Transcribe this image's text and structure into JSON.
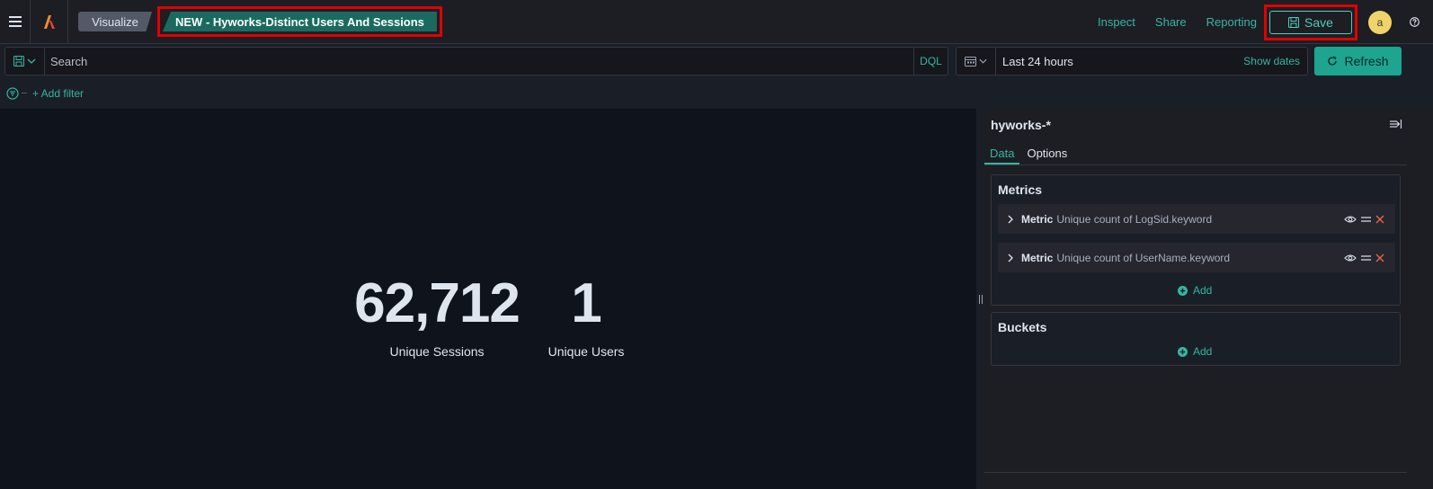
{
  "header": {
    "breadcrumbs": [
      "Visualize",
      "NEW - Hyworks-Distinct Users And Sessions"
    ],
    "links": {
      "inspect": "Inspect",
      "share": "Share",
      "reporting": "Reporting"
    },
    "save_label": "Save",
    "avatar_initial": "a",
    "icons": [
      "menu-icon",
      "logo-icon",
      "save-icon",
      "help-icon"
    ]
  },
  "query": {
    "search_placeholder": "Search",
    "language": "DQL",
    "date_range": "Last 24 hours",
    "show_dates_label": "Show dates",
    "refresh_label": "Refresh"
  },
  "filters": {
    "add_filter_label": "+ Add filter"
  },
  "visualization": {
    "metrics": [
      {
        "value": "62,712",
        "label": "Unique Sessions"
      },
      {
        "value": "1",
        "label": "Unique Users"
      }
    ]
  },
  "sidebar": {
    "index_pattern": "hyworks-*",
    "tabs": [
      "Data",
      "Options"
    ],
    "active_tab": "Data",
    "metrics_title": "Metrics",
    "metric_aggs": [
      {
        "type": "Metric",
        "description": "Unique count of LogSid.keyword"
      },
      {
        "type": "Metric",
        "description": "Unique count of UserName.keyword"
      }
    ],
    "buckets_title": "Buckets",
    "add_label": "Add"
  },
  "colors": {
    "accent": "#36b5a3",
    "primary_button": "#1da590",
    "highlight_box": "#e10000",
    "delete": "#e7664c",
    "avatar": "#f0d46a"
  }
}
